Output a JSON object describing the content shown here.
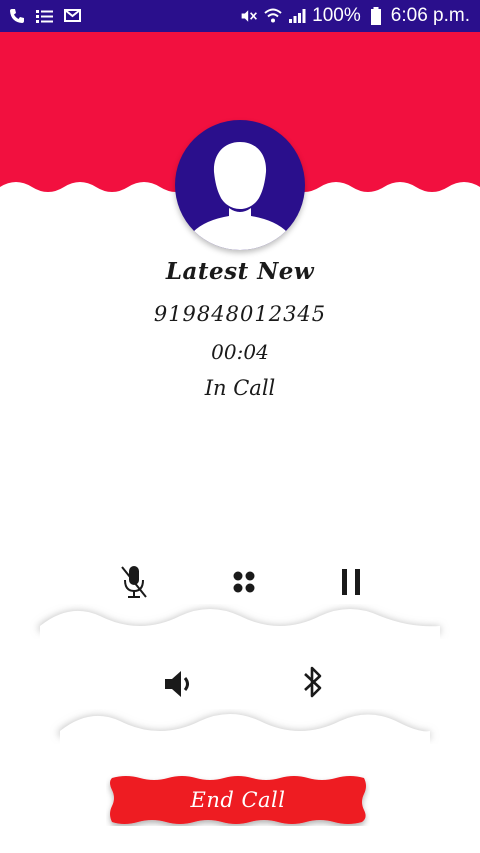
{
  "status_bar": {
    "battery_percent": "100%",
    "time": "6:06 p.m.",
    "left_icons": [
      "phone-icon",
      "list-icon",
      "mail-icon"
    ],
    "right_icons": [
      "mute-icon",
      "wifi-icon",
      "signal-icon",
      "battery-icon"
    ]
  },
  "caller": {
    "name": "Latest New",
    "number": "919848012345",
    "duration": "00:04",
    "status": "In Call"
  },
  "controls": {
    "row1": [
      "mute-mic-icon",
      "keypad-icon",
      "pause-icon"
    ],
    "row2": [
      "speaker-icon",
      "bluetooth-icon"
    ]
  },
  "end_call_label": "End Call",
  "colors": {
    "status_bar": "#2a0f8c",
    "header_red": "#f2103f",
    "avatar_bg": "#2a0f8c",
    "end_call_red": "#ee1b24"
  }
}
